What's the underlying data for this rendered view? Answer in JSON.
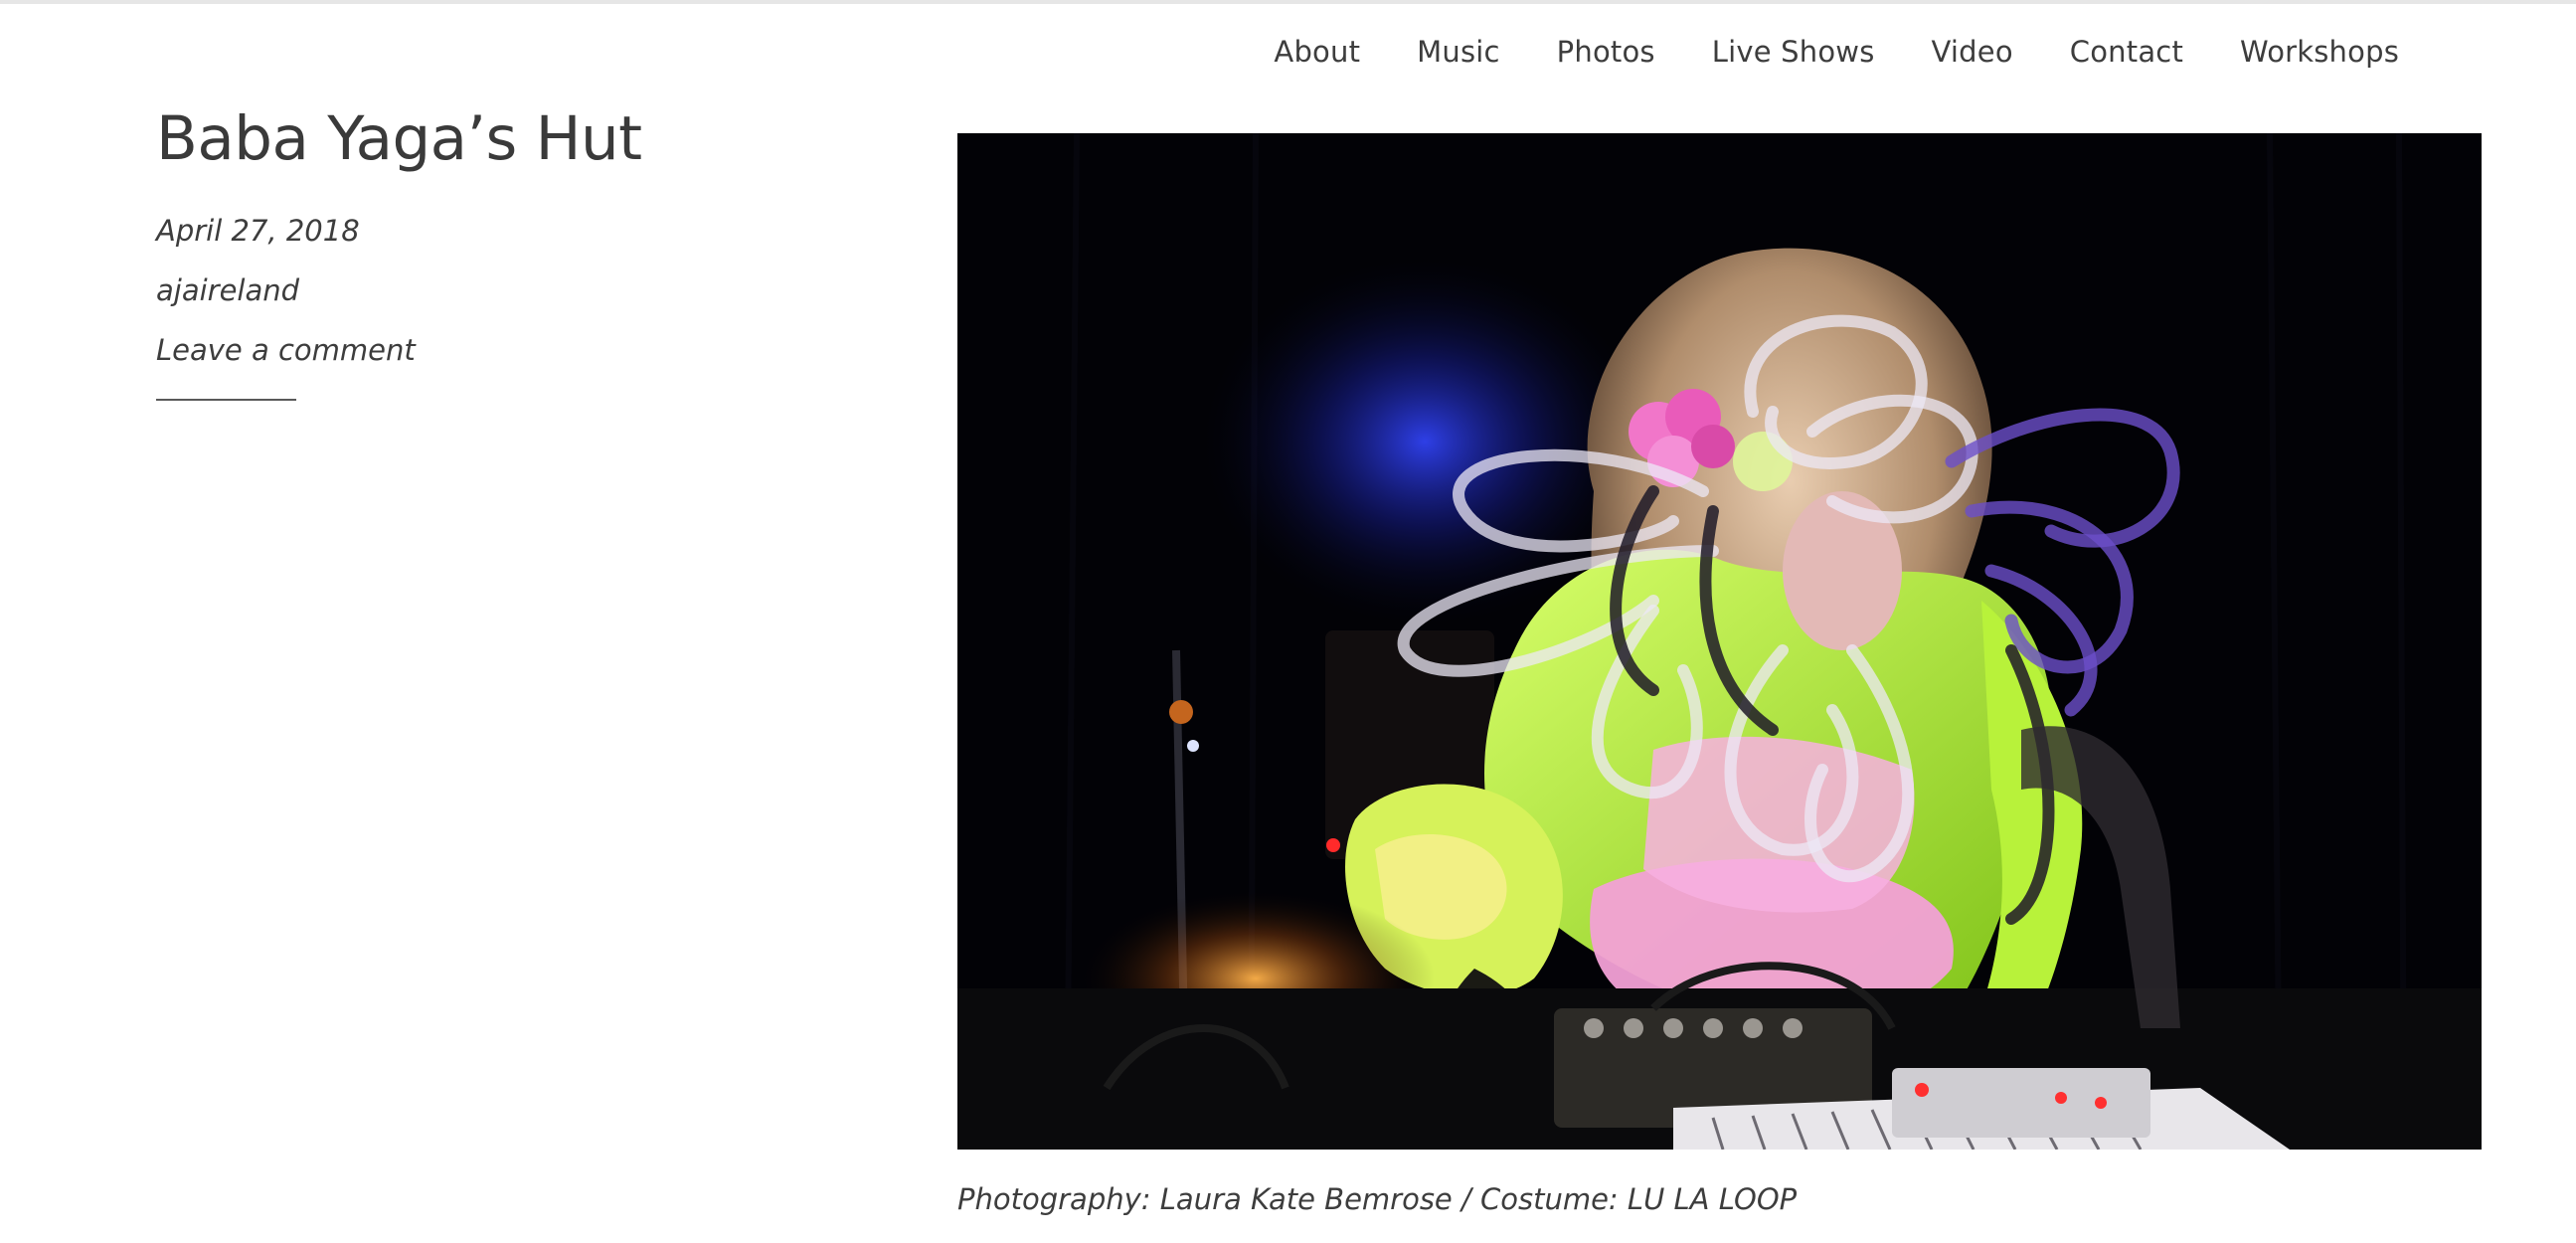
{
  "nav": {
    "items": [
      {
        "label": "About"
      },
      {
        "label": "Music"
      },
      {
        "label": "Photos"
      },
      {
        "label": "Live Shows"
      },
      {
        "label": "Video"
      },
      {
        "label": "Contact"
      },
      {
        "label": "Workshops"
      }
    ]
  },
  "post": {
    "title": "Baba Yaga’s Hut",
    "date": "April 27, 2018",
    "author": "ajaireland",
    "comment_link": "Leave a comment",
    "caption": "Photography: Laura Kate Bemrose / Costume: LU LA LOOP"
  },
  "photo": {
    "subject": "performer-in-neon-costume-at-synth-rig",
    "colors": {
      "background": "#020206",
      "neon_green": "#b6f03c",
      "pink": "#f08ad0",
      "blue_light": "#2a3cff",
      "hair": "#c9a98a",
      "tubes": "#e8e4f2"
    }
  }
}
